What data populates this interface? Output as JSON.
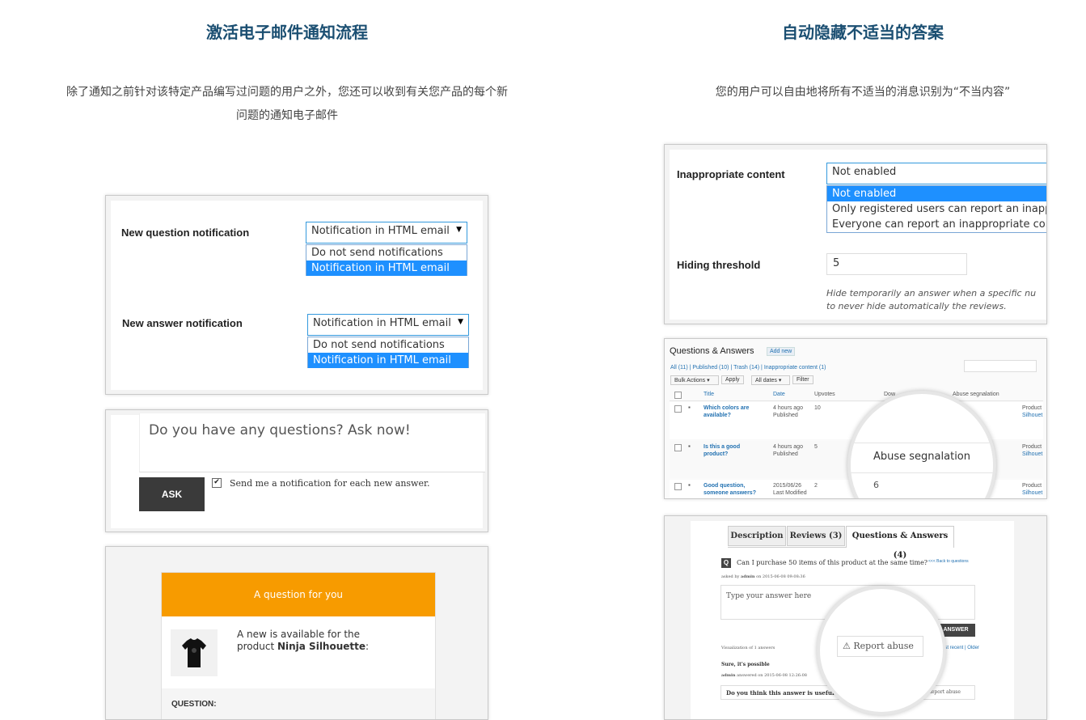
{
  "left": {
    "title": "激活电子邮件通知流程",
    "desc_line1": "除了通知之前针对该特定产品编写过问题的用户之外，您还可以收到有关您产品的每个新",
    "desc_line2": "问题的通知电子邮件",
    "notif": {
      "q_label": "New question notification",
      "q_value": "Notification in HTML email",
      "a_label": "New answer notification",
      "a_value": "Notification in HTML email",
      "options": [
        "Do not send notifications",
        "Notification in HTML email"
      ]
    },
    "ask": {
      "placeholder": "Do you have any questions? Ask now!",
      "button": "ASK",
      "checkbox_label": "Send me a notification for each new answer."
    },
    "email": {
      "header": "A question for you",
      "body_prefix": "A new is available for the",
      "body_line2_prefix": "product ",
      "product_name": "Ninja Silhouette",
      "body_suffix": ":",
      "question_label": "QUESTION:"
    }
  },
  "right": {
    "title": "自动隐藏不适当的答案",
    "desc": "您的用户可以自由地将所有不适当的消息识别为“不当内容”",
    "settings": {
      "inappropriate_label": "Inappropriate content",
      "inappropriate_value": "Not enabled",
      "options": [
        "Not enabled",
        "Only registered users can report an inappr",
        "Everyone can report an inappropriate con"
      ],
      "threshold_label": "Hiding threshold",
      "threshold_value": "5",
      "help_line1": "Hide temporarily an answer when a specific nu",
      "help_line2": "to never hide automatically the reviews."
    },
    "admin": {
      "heading": "Questions & Answers",
      "add_new": "Add new",
      "filters": "All (11) | Published (10) | Trash (14) | Inappropriate content (1)",
      "bulk": "Bulk Actions",
      "apply": "Apply",
      "all_dates": "All dates",
      "filter": "Filter",
      "columns": [
        "Title",
        "Date",
        "Upvotes",
        "Dow",
        "Abuse segnalation"
      ],
      "rows": [
        {
          "title1": "Which colors are",
          "title2": "available?",
          "date1": "4 hours ago",
          "date2": "Published",
          "upvotes": "10",
          "product1": "Product",
          "product2": "Silhouet"
        },
        {
          "title1": "Is this a good",
          "title2": "product?",
          "date1": "4 hours ago",
          "date2": "Published",
          "upvotes": "5",
          "product1": "Product",
          "product2": "Silhouet"
        },
        {
          "title1": "Good question,",
          "title2": "someone answers?",
          "date1": "2015/06/26",
          "date2": "Last Modified",
          "upvotes": "2",
          "product1": "Product",
          "product2": "Silhouet"
        }
      ],
      "zoom_header": "Abuse segnalation",
      "zoom_value": "6"
    },
    "product": {
      "tabs": [
        "Description",
        "Reviews (3)",
        "Questions & Answers (4)"
      ],
      "question": "Can I purchase 50 items of this product at the same time?",
      "q_badge": "Q",
      "back": "<<< Back to questions",
      "asked_by_prefix": "asked by ",
      "asked_by_user": "admin",
      "asked_by_suffix": " on 2015-06-08 09:08:36",
      "answer_placeholder": "Type your answer here",
      "answer_button": "ANSWER",
      "visualization": "Visualization of 1 answers",
      "sort": "Most recent | Older",
      "answer_text": "Sure, it's possible",
      "answered_user": "admin",
      "answered_suffix": " answered on 2015-06-08 12:26:08",
      "useful": "Do you think this answer is useful?",
      "report_small": "Report abuse",
      "report_zoom": "Report abuse"
    }
  }
}
